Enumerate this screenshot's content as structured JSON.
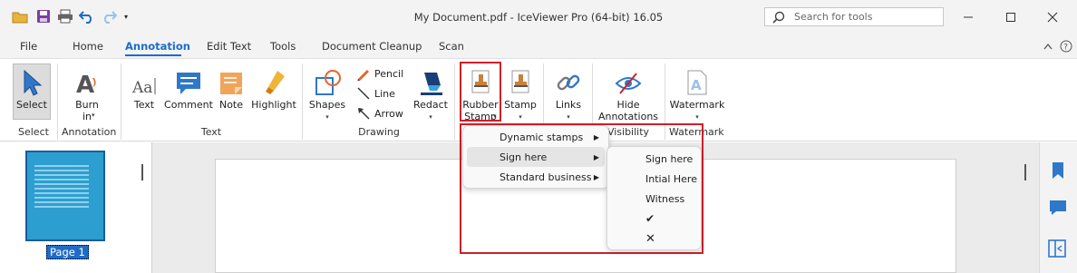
{
  "window": {
    "title": "My Document.pdf - IceViewer Pro (64-bit) 16.05",
    "search_placeholder": "Search for tools"
  },
  "tabs": [
    {
      "label": "File"
    },
    {
      "label": "Home"
    },
    {
      "label": "Annotation",
      "active": true
    },
    {
      "label": "Edit Text"
    },
    {
      "label": "Tools"
    },
    {
      "label": "Document Cleanup"
    },
    {
      "label": "Scan"
    }
  ],
  "ribbon": {
    "select": "Select",
    "burn_in_1": "Burn",
    "burn_in_2": "in",
    "text": "Text",
    "comment": "Comment",
    "note": "Note",
    "highlight": "Highlight",
    "shapes": "Shapes",
    "pencil": "Pencil",
    "line": "Line",
    "arrow": "Arrow",
    "redact": "Redact",
    "rubber_stamp_1": "Rubber",
    "rubber_stamp_2": "Stamp",
    "stamp": "Stamp",
    "links": "Links",
    "hide_annotations_1": "Hide",
    "hide_annotations_2": "Annotations",
    "watermark": "Watermark"
  },
  "groups": {
    "select": "Select",
    "annotation": "Annotation",
    "text": "Text",
    "drawing": "Drawing",
    "visibility": "Visibility",
    "watermark": "Watermark"
  },
  "stamp_menu": [
    {
      "label": "Dynamic stamps"
    },
    {
      "label": "Sign here"
    },
    {
      "label": "Standard business"
    }
  ],
  "sign_here_submenu": [
    {
      "label": "Sign here"
    },
    {
      "label": "Intial Here"
    },
    {
      "label": "Witness"
    },
    {
      "label": "✔"
    },
    {
      "label": "✕"
    }
  ],
  "thumbnail": {
    "label": "Page 1"
  },
  "colors": {
    "accent": "#1e6cc8",
    "highlight_box": "#d0202a"
  }
}
